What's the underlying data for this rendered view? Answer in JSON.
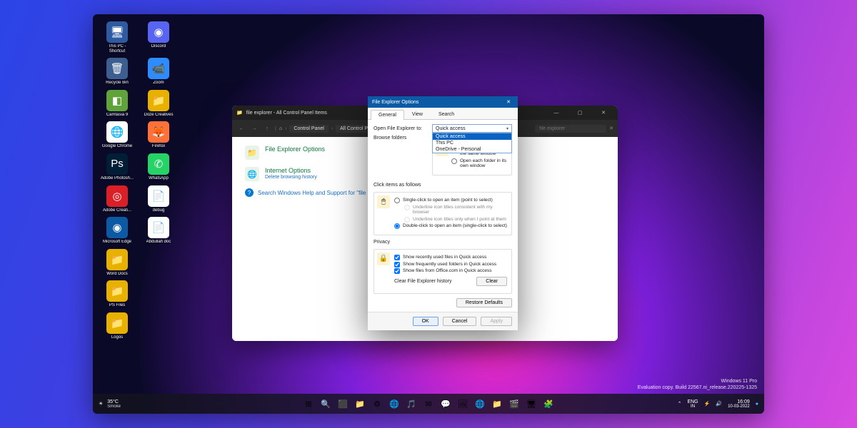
{
  "desktop_icons": [
    {
      "label": "This PC - Shortcut",
      "bg": "#2d5aa0",
      "glyph": "🖥"
    },
    {
      "label": "Discord",
      "bg": "#5865f2",
      "glyph": "◉"
    },
    {
      "label": "Recycle Bin",
      "bg": "#3d5f8f",
      "glyph": "🗑"
    },
    {
      "label": "Zoom",
      "bg": "#2d8cff",
      "glyph": "📹"
    },
    {
      "label": "Camtasia 9",
      "bg": "#5fa33a",
      "glyph": "◧"
    },
    {
      "label": "Doze Creatives",
      "bg": "#e8b100",
      "glyph": "📁"
    },
    {
      "label": "Google Chrome",
      "bg": "#ffffff",
      "glyph": "🌐"
    },
    {
      "label": "Firefox",
      "bg": "#ff7139",
      "glyph": "🦊"
    },
    {
      "label": "Adobe Photosh...",
      "bg": "#001e36",
      "glyph": "Ps"
    },
    {
      "label": "WhatsApp",
      "bg": "#25d366",
      "glyph": "✆"
    },
    {
      "label": "Adobe Creati...",
      "bg": "#da1f26",
      "glyph": "◎"
    },
    {
      "label": "debug",
      "bg": "#ffffff",
      "glyph": "📄"
    },
    {
      "label": "Microsoft Edge",
      "bg": "#0c59a4",
      "glyph": "◉"
    },
    {
      "label": "Abdullah doc",
      "bg": "#ffffff",
      "glyph": "📄"
    },
    {
      "label": "Word Docs",
      "bg": "#e8b100",
      "glyph": "📁"
    },
    {
      "label": "",
      "bg": "transparent",
      "glyph": ""
    },
    {
      "label": "PS Files",
      "bg": "#e8b100",
      "glyph": "📁"
    },
    {
      "label": "",
      "bg": "transparent",
      "glyph": ""
    },
    {
      "label": "Logos",
      "bg": "#e8b100",
      "glyph": "📁"
    }
  ],
  "cp": {
    "title": "file explorer - All Control Panel Items",
    "crumbs": [
      "Control Panel",
      "All Control Panel Items"
    ],
    "search_ph": "file explorer",
    "items": [
      {
        "label": "File Explorer Options",
        "glyph": "📁"
      },
      {
        "label": "Internet Options",
        "sub": "Delete browsing history",
        "glyph": "🌐"
      }
    ],
    "help": "Search Windows Help and Support for \"file explorer\""
  },
  "dlg": {
    "title": "File Explorer Options",
    "tabs": [
      "General",
      "View",
      "Search"
    ],
    "open_label": "Open File Explorer to:",
    "open_sel": "Quick access",
    "open_opts": [
      "Quick access",
      "This PC",
      "OneDrive - Personal"
    ],
    "browse_label": "Browse folders",
    "browse": [
      {
        "t": "Open each folder in the same window",
        "c": true
      },
      {
        "t": "Open each folder in its own window",
        "c": false
      }
    ],
    "click_label": "Click items as follows",
    "click": [
      {
        "t": "Single-click to open an item (point to select)",
        "c": false
      },
      {
        "t": "Underline icon titles consistent with my browser",
        "c": false,
        "sub": true,
        "dis": true
      },
      {
        "t": "Underline icon titles only when I point at them",
        "c": false,
        "sub": true,
        "dis": true
      },
      {
        "t": "Double-click to open an item (single-click to select)",
        "c": true
      }
    ],
    "privacy_label": "Privacy",
    "privacy": [
      {
        "t": "Show recently used files in Quick access",
        "c": true
      },
      {
        "t": "Show frequently used folders in Quick access",
        "c": true
      },
      {
        "t": "Show files from Office.com in Quick access",
        "c": true
      }
    ],
    "clear_label": "Clear File Explorer history",
    "clear_btn": "Clear",
    "restore": "Restore Defaults",
    "ok": "OK",
    "cancel": "Cancel",
    "apply": "Apply"
  },
  "taskbar": {
    "weather_temp": "35°C",
    "weather_cond": "Smoke",
    "lang": "ENG",
    "region": "IN",
    "time": "16:09",
    "date": "10-03-2022",
    "apps": [
      "⊞",
      "🔍",
      "⬛",
      "📁",
      "⚙",
      "🌐",
      "🎵",
      "✉",
      "💬",
      "🖼",
      "🌐",
      "📁",
      "🎬",
      "🖥",
      "🧩"
    ]
  },
  "watermark": {
    "l1": "Windows 11 Pro",
    "l2": "Evaluation copy. Build 22567.ni_release.220225-1325"
  }
}
